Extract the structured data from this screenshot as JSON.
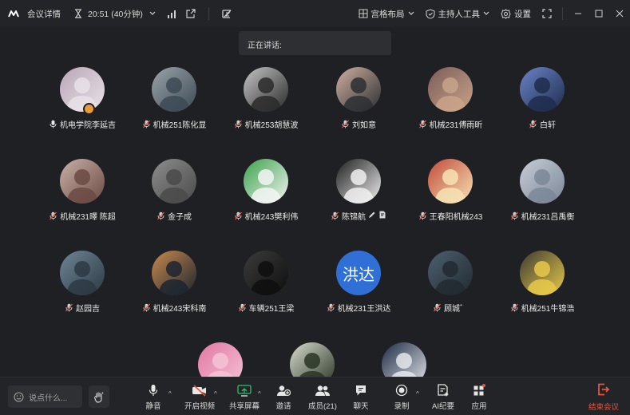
{
  "titlebar": {
    "meeting_details": "会议详情",
    "time": "20:51 (40分钟)",
    "layout": "宫格布局",
    "host_tools": "主持人工具",
    "settings": "设置"
  },
  "speaking": {
    "label": "正在讲话:"
  },
  "participants": [
    {
      "name": "机电学院李延吉",
      "mic": "on"
    },
    {
      "name": "机械251陈化显",
      "mic": "muted"
    },
    {
      "name": "机械253胡慧波",
      "mic": "muted"
    },
    {
      "name": "刘如意",
      "mic": "muted"
    },
    {
      "name": "机械231傅雨昕",
      "mic": "muted"
    },
    {
      "name": "白轩",
      "mic": "muted"
    },
    {
      "name": "机械231曎 陈超",
      "mic": "muted"
    },
    {
      "name": "金子成",
      "mic": "muted"
    },
    {
      "name": "机械243樊利伟",
      "mic": "muted"
    },
    {
      "name": "陈锦航",
      "mic": "muted"
    },
    {
      "name": "王春阳机械243",
      "mic": "muted"
    },
    {
      "name": "机械231吕禹衡",
      "mic": "muted"
    },
    {
      "name": "赵园吉",
      "mic": "muted"
    },
    {
      "name": "机械243宋科南",
      "mic": "muted"
    },
    {
      "name": "车辆251王梁",
      "mic": "muted"
    },
    {
      "name": "机械231王洪达",
      "mic": "muted",
      "avatar_text": "洪达"
    },
    {
      "name": "顾城゛",
      "mic": "muted"
    },
    {
      "name": "机械251牛锦浩",
      "mic": "muted"
    },
    {
      "name": "",
      "mic": ""
    },
    {
      "name": "",
      "mic": ""
    },
    {
      "name": "",
      "mic": ""
    }
  ],
  "toolbar": {
    "chat_placeholder": "说点什么...",
    "mute": "静音",
    "video": "开启视频",
    "share": "共享屏幕",
    "invite": "邀请",
    "members": "成员(21)",
    "chat": "聊天",
    "record": "录制",
    "ai_notes": "AI纪要",
    "apps": "应用",
    "end": "结束会议"
  },
  "colors": {
    "background": "#1f2023",
    "end_button": "#e8553f",
    "avatar_blue": "#2f6fd6"
  }
}
